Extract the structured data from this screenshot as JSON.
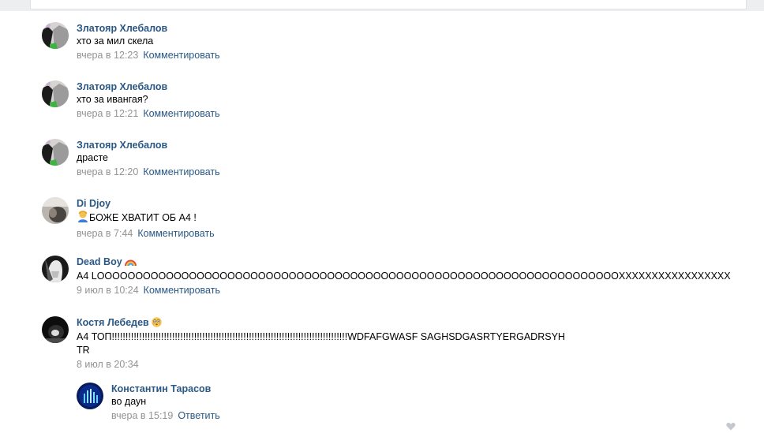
{
  "comments": [
    {
      "author": "Златояр Хлебалов",
      "text": "хто за мил скела",
      "date": "вчера в 12:23",
      "action": "Комментировать"
    },
    {
      "author": "Златояр Хлебалов",
      "text": "хто за ивангая?",
      "date": "вчера в 12:21",
      "action": "Комментировать"
    },
    {
      "author": "Златояр Хлебалов",
      "text": "драсте",
      "date": "вчера в 12:20",
      "action": "Комментировать"
    },
    {
      "author": "Di Djoy",
      "text": "БОЖЕ ХВАТИТ ОБ А4 !",
      "date": "вчера в 7:44",
      "action": "Комментировать"
    },
    {
      "author": "Dead Boy",
      "text": "А4 LOOOOOOOOOOOOOOOOOOOOOOOOOOOOOOOOOOOOOOOOOOOOOOOOOOOOOOOOOOOOOOOOOOOOXXXXXXXXXXXXXXXXX",
      "date": "9 июл в 10:24",
      "action": "Комментировать"
    },
    {
      "author": "Костя Лебедев",
      "text": "А4 ТОП!!!!!!!!!!!!!!!!!!!!!!!!!!!!!!!!!!!!!!!!!!!!!!!!!!!!!!!!!!!!!!!!!!!!!!!!!!!!!!!!!!!!!!WDFAFGWASF SAGHSDGASRTYERGADRSYH",
      "text2": "TR",
      "date": "8 июл в 20:34"
    }
  ],
  "reply": {
    "author": "Константин Тарасов",
    "text": "во даун",
    "date": "вчера в 15:19",
    "action": "Ответить"
  },
  "icons": {
    "like": "heart-icon",
    "emoji_dead_boy": "rainbow-emoji",
    "emoji_kostya": "flushed-face-emoji",
    "emoji_djoy": "person-emoji"
  },
  "colors": {
    "link": "#2a5885",
    "meta": "#939393",
    "background": "#edeef0"
  }
}
